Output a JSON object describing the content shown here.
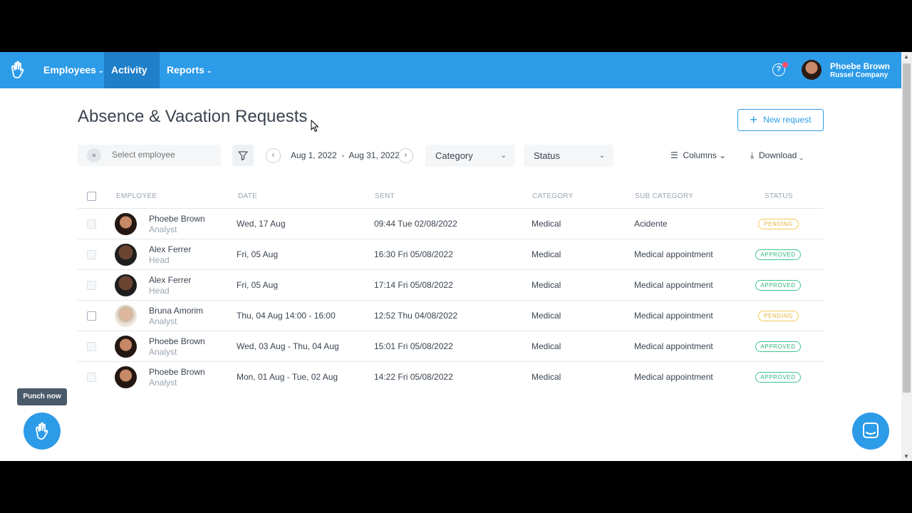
{
  "nav": {
    "items": [
      {
        "label": "Employees"
      },
      {
        "label": "Activity"
      },
      {
        "label": "Reports"
      }
    ],
    "active": "Activity",
    "user": {
      "name": "Phoebe Brown",
      "company": "Russel Company"
    },
    "help": "?"
  },
  "page": {
    "title": "Absence & Vacation Requests",
    "new_request_label": "New request"
  },
  "filters": {
    "employee_placeholder": "Select employee",
    "date_from": "Aug 1, 2022",
    "date_sep": "-",
    "date_to": "Aug 31, 2022",
    "category_label": "Category",
    "status_label": "Status",
    "columns_label": "Columns",
    "download_label": "Download"
  },
  "table": {
    "headers": {
      "employee": "EMPLOYEE",
      "date": "DATE",
      "sent": "SENT",
      "category": "CATEGORY",
      "subcategory": "SUB CATEGORY",
      "status": "STATUS"
    },
    "rows": [
      {
        "name": "Phoebe Brown",
        "role": "Analyst",
        "date": "Wed, 17 Aug",
        "sent": "09:44 Tue 02/08/2022",
        "category": "Medical",
        "subcategory": "Acidente",
        "status": "PENDING"
      },
      {
        "name": "Alex Ferrer",
        "role": "Head",
        "date": "Fri, 05 Aug",
        "sent": "16:30 Fri 05/08/2022",
        "category": "Medical",
        "subcategory": "Medical appointment",
        "status": "APPROVED"
      },
      {
        "name": "Alex Ferrer",
        "role": "Head",
        "date": "Fri, 05 Aug",
        "sent": "17:14 Fri 05/08/2022",
        "category": "Medical",
        "subcategory": "Medical appointment",
        "status": "APPROVED"
      },
      {
        "name": "Bruna Amorim",
        "role": "Analyst",
        "date": "Thu, 04 Aug 14:00 - 16:00",
        "sent": "12:52 Thu 04/08/2022",
        "category": "Medical",
        "subcategory": "Medical appointment",
        "status": "PENDING"
      },
      {
        "name": "Phoebe Brown",
        "role": "Analyst",
        "date": "Wed, 03 Aug - Thu, 04 Aug",
        "sent": "15:01 Fri 05/08/2022",
        "category": "Medical",
        "subcategory": "Medical appointment",
        "status": "APPROVED"
      },
      {
        "name": "Phoebe Brown",
        "role": "Analyst",
        "date": "Mon, 01 Aug - Tue, 02 Aug",
        "sent": "14:22 Fri 05/08/2022",
        "category": "Medical",
        "subcategory": "Medical appointment",
        "status": "APPROVED"
      }
    ]
  },
  "punch": {
    "label": "Punch now"
  },
  "colors": {
    "brand": "#2c9be8",
    "active_nav": "#1f7fc9",
    "pending": "#e0b439",
    "approved": "#2fb47e"
  }
}
